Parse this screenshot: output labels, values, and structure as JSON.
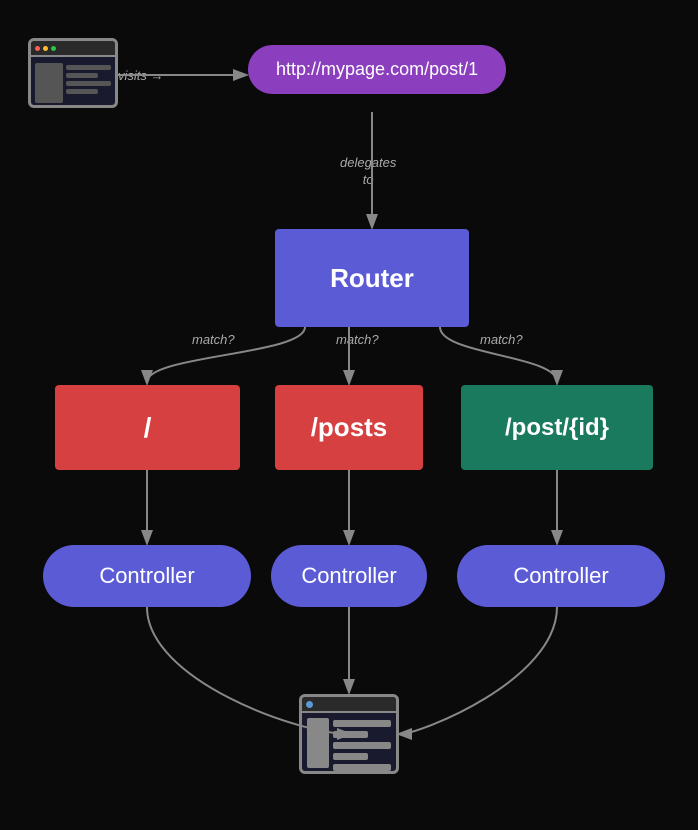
{
  "background": "#0a0a0a",
  "url": {
    "text": "http://mypage.com/post/1",
    "bg": "#8b3fbe"
  },
  "router": {
    "label": "Router",
    "bg": "#5b5bd6"
  },
  "routes": [
    {
      "path": "/",
      "bg": "#d64040"
    },
    {
      "path": "/posts",
      "bg": "#d64040"
    },
    {
      "path": "/post/{id}",
      "bg": "#1a7a5e"
    }
  ],
  "controllers": [
    {
      "label": "Controller"
    },
    {
      "label": "Controller"
    },
    {
      "label": "Controller"
    }
  ],
  "labels": {
    "visits": "visits",
    "delegates_to": "delegates\nto",
    "match": "match?"
  }
}
